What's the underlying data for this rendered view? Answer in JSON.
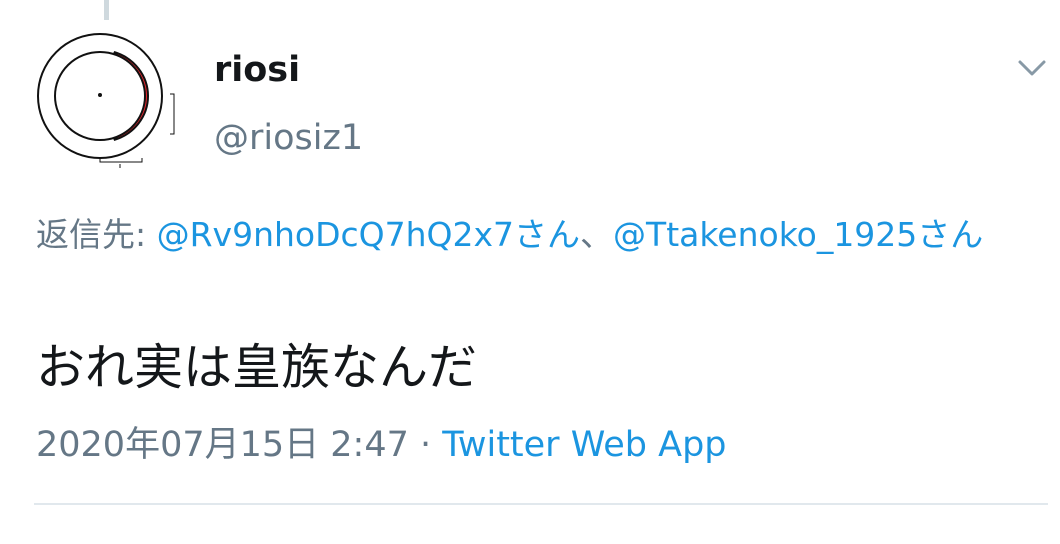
{
  "author": {
    "display_name": "riosi",
    "handle": "@riosiz1"
  },
  "reply": {
    "prefix": "返信先: ",
    "mentions": [
      "@Rv9nhoDcQ7hQ2x7さん",
      "@Ttakenoko_1925さん"
    ],
    "separator": "、"
  },
  "tweet": {
    "text": "おれ実は皇族なんだ",
    "timestamp": "2020年07月15日 2:47",
    "dot": " · ",
    "source": "Twitter Web App"
  },
  "icons": {
    "menu": "chevron-down-icon",
    "avatar": "ring-avatar-icon"
  },
  "colors": {
    "link": "#1b95e0",
    "secondary_text": "#657786",
    "primary_text": "#14171a",
    "avatar_accent": "#e8262d"
  }
}
